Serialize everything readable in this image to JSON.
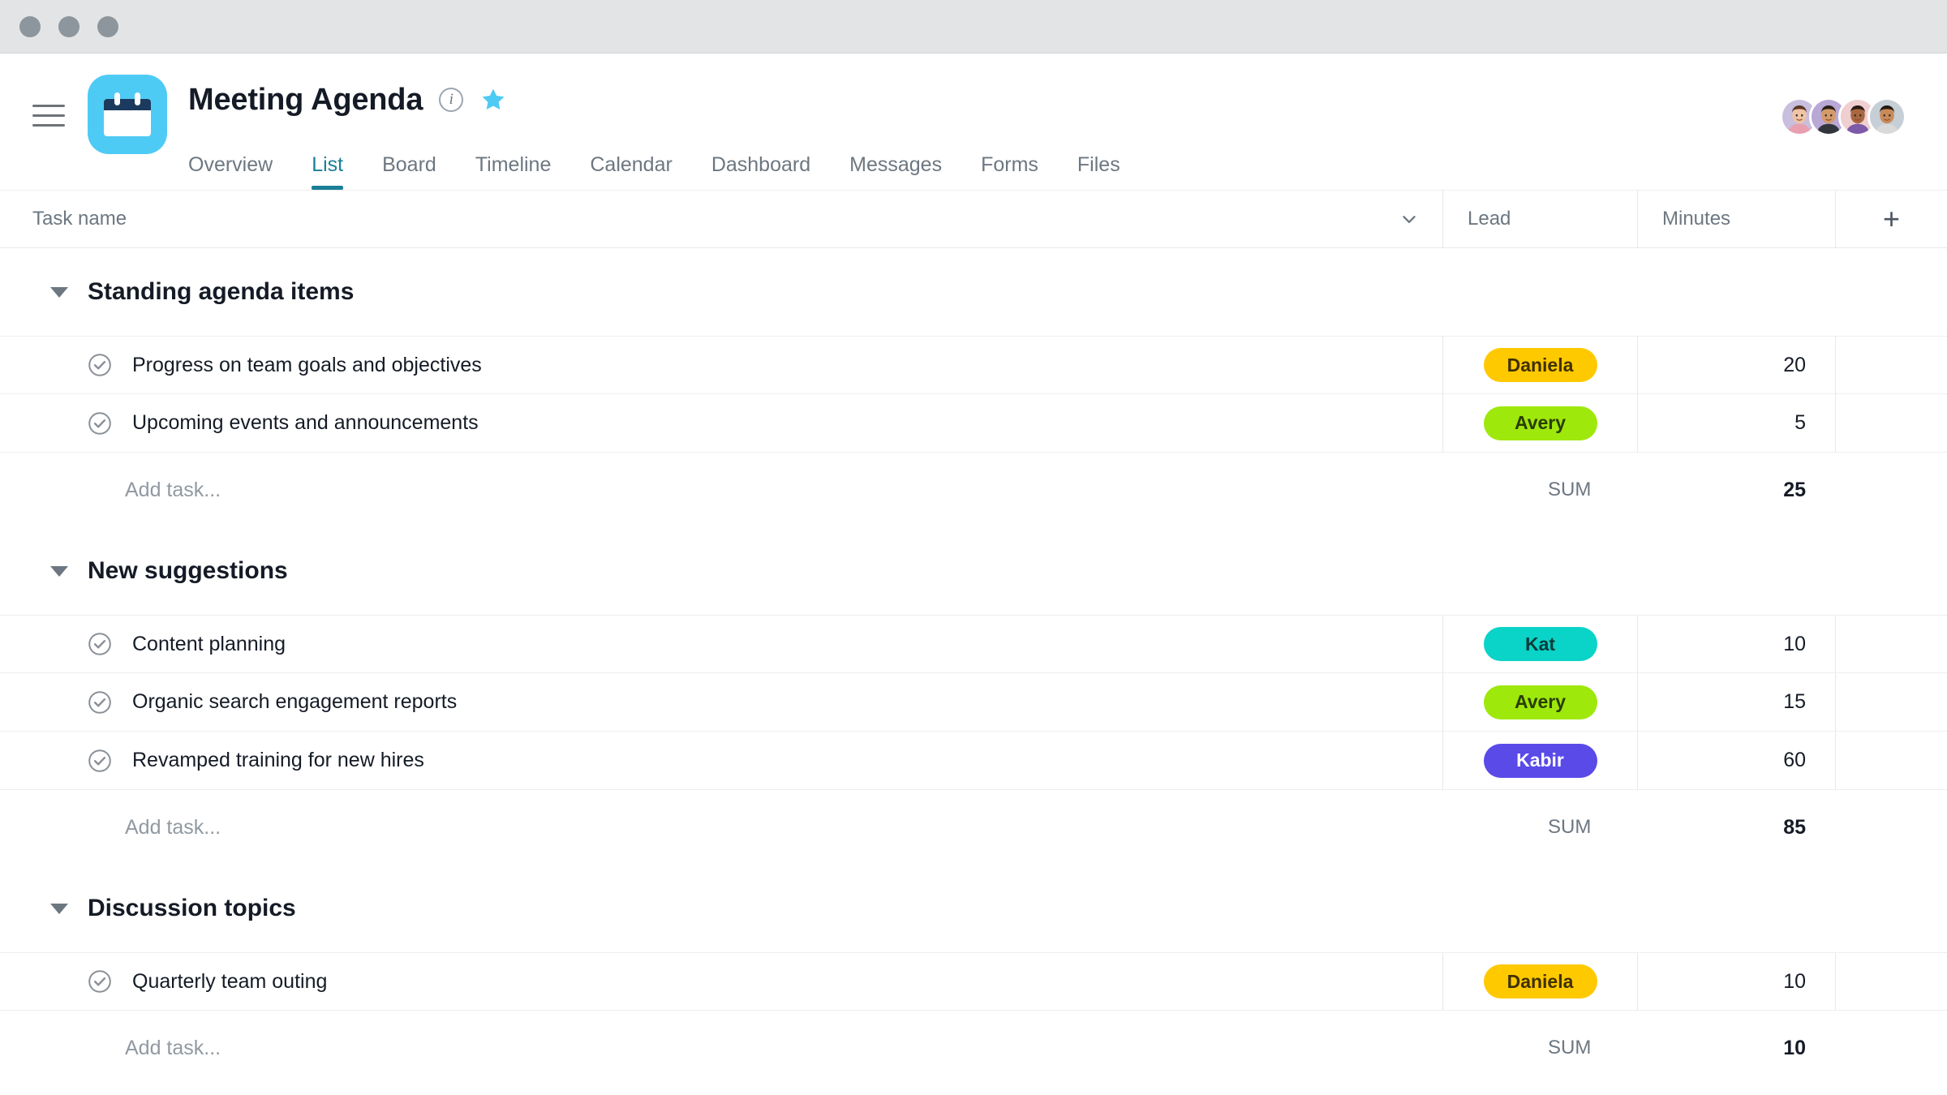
{
  "window": {
    "dots": [
      "close",
      "minimize",
      "maximize"
    ]
  },
  "header": {
    "menu_icon": "hamburger-menu-icon",
    "project_icon": "calendar-icon",
    "title": "Meeting Agenda",
    "info_icon": "info-icon",
    "info_glyph": "i",
    "star_icon": "star-icon",
    "star_color": "#4ecbf5",
    "icon_bg_color": "#4ecbf5"
  },
  "tabs": [
    {
      "label": "Overview",
      "active": false
    },
    {
      "label": "List",
      "active": true
    },
    {
      "label": "Board",
      "active": false
    },
    {
      "label": "Timeline",
      "active": false
    },
    {
      "label": "Calendar",
      "active": false
    },
    {
      "label": "Dashboard",
      "active": false
    },
    {
      "label": "Messages",
      "active": false
    },
    {
      "label": "Forms",
      "active": false
    },
    {
      "label": "Files",
      "active": false
    }
  ],
  "active_tab_color": "#1a7f96",
  "members": [
    {
      "name": "member-1",
      "bg": "#c8bedd",
      "skin": "#f0c3a5",
      "hair": "#5a3825",
      "shirt": "#e8a0b0"
    },
    {
      "name": "member-2",
      "bg": "#b9a7d6",
      "skin": "#d49a6a",
      "hair": "#2b2018",
      "shirt": "#31353c"
    },
    {
      "name": "member-3",
      "bg": "#f0cfd0",
      "skin": "#a8673f",
      "hair": "#2a1a12",
      "shirt": "#7d5aa8"
    },
    {
      "name": "member-4",
      "bg": "#c6ced6",
      "skin": "#c98a58",
      "hair": "#241812",
      "shirt": "#d9d9d9"
    }
  ],
  "columns": {
    "task_name": "Task name",
    "sort_icon": "chevron-down-icon",
    "lead": "Lead",
    "minutes": "Minutes",
    "add_column_icon": "plus-icon"
  },
  "add_task_placeholder": "Add task...",
  "sum_label": "SUM",
  "sections": [
    {
      "title": "Standing agenda items",
      "expanded": true,
      "tasks": [
        {
          "name": "Progress on team goals and objectives",
          "lead": "Daniela",
          "lead_bg": "#ffc900",
          "lead_fg": "#3f3000",
          "minutes": "20"
        },
        {
          "name": "Upcoming events and announcements",
          "lead": "Avery",
          "lead_bg": "#9ee80b",
          "lead_fg": "#2a3d00",
          "minutes": "5"
        }
      ],
      "sum": "25"
    },
    {
      "title": "New suggestions",
      "expanded": true,
      "tasks": [
        {
          "name": "Content planning",
          "lead": "Kat",
          "lead_bg": "#0ad3c8",
          "lead_fg": "#083c39",
          "minutes": "10"
        },
        {
          "name": "Organic search engagement reports",
          "lead": "Avery",
          "lead_bg": "#9ee80b",
          "lead_fg": "#2a3d00",
          "minutes": "15"
        },
        {
          "name": "Revamped training for new hires",
          "lead": "Kabir",
          "lead_bg": "#5a4ae8",
          "lead_fg": "#ffffff",
          "minutes": "60"
        }
      ],
      "sum": "85"
    },
    {
      "title": "Discussion topics",
      "expanded": true,
      "tasks": [
        {
          "name": "Quarterly team outing",
          "lead": "Daniela",
          "lead_bg": "#ffc900",
          "lead_fg": "#3f3000",
          "minutes": "10"
        }
      ],
      "sum": "10"
    }
  ]
}
